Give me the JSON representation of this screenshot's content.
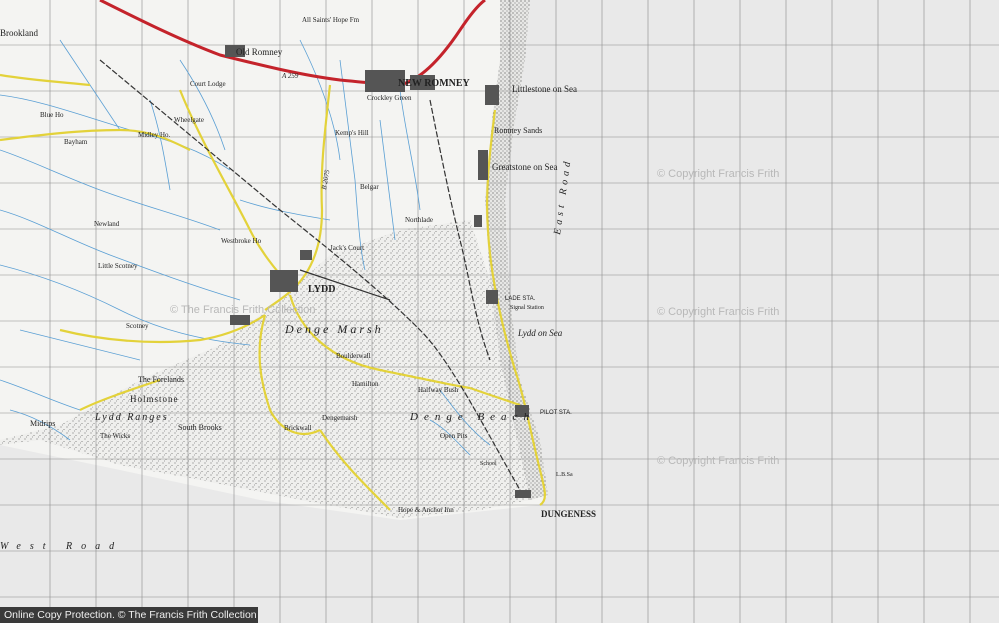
{
  "place_labels": {
    "new_romney": "NEW ROMNEY",
    "old_romney": "Old Romney",
    "littlestone": "Littlestone on Sea",
    "greatstone": "Greatstone on Sea",
    "romney_sands": "Romney Sands",
    "lydd": "LYDD",
    "lydd_on_sea": "Lydd on Sea",
    "dungeness": "DUNGENESS",
    "denge_marsh": "Denge Marsh",
    "denge_beach": "Denge Beach",
    "east_road": "East Road",
    "west_road": "West Road",
    "lydd_ranges": "Lydd Ranges",
    "holmstone": "Holmstone",
    "the_forelands": "The Forelands",
    "south_brooks": "South Brooks",
    "the_wicks": "The Wicks",
    "midrips": "Midrips",
    "brookland": "Brookland",
    "all_saints": "All Saints' Hope Fm",
    "crockley_green": "Crockley Green",
    "westbroke": "Westbroke Ho",
    "jacks_court": "Jack's Court",
    "boulderwall": "Boulderwall",
    "hamilton": "Hamilton",
    "halfway_bush": "Halfway Bush",
    "dengemarsh": "Dengemarsh",
    "brickwall": "Brickwall",
    "open_pits": "Open Pits",
    "hope_anchor": "Hope & Anchor Inn",
    "lade_sta": "LADE STA.",
    "signal_station": "Signal Station",
    "pilot_sta": "PILOT STA.",
    "north_lade": "Northlade",
    "belgar": "Belgar",
    "kemps_hill": "Kemp's Hill",
    "midley": "Midley Ho.",
    "newland": "Newland",
    "little_scotney": "Little Scotney",
    "scotney": "Scotney",
    "court_lodge": "Court Lodge",
    "wheelgate": "Wheelgate",
    "bayham": "Bayham",
    "blue_ho": "Blue Ho",
    "school": "School",
    "lbsa": "L.B.Sa",
    "road_a259": "A 259",
    "road_b2075": "B 2075"
  },
  "watermarks": {
    "upper": "© Copyright Francis Frith",
    "middle": "© Copyright Francis Frith",
    "lower": "© Copyright Francis Frith",
    "map_centre": "© The Francis Frith Collection"
  },
  "footer": {
    "text": "Online Copy Protection.  © The Francis Frith Collection"
  },
  "colors": {
    "paper": "#f4f4f2",
    "background": "#e9e9e9",
    "main_road": "#c4232b",
    "minor_road": "#e3d23a",
    "water": "#5a9fd4",
    "grid": "#8a8a8a",
    "shingle": "#d8d8d8",
    "railway": "#333333"
  }
}
